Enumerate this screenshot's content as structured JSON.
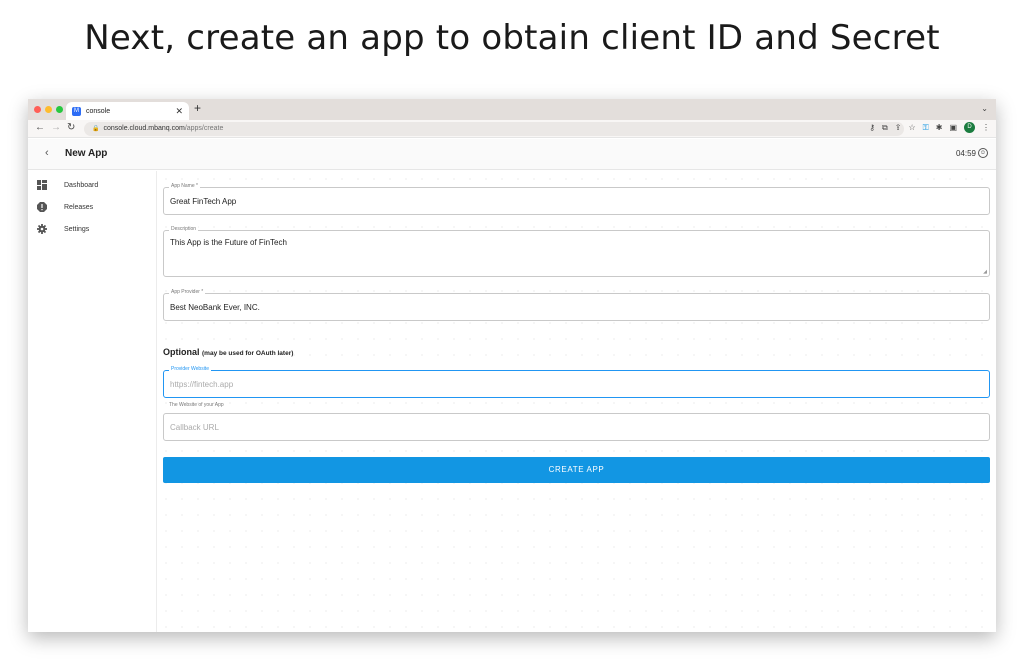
{
  "headline": "Next, create an app to obtain client ID and Secret",
  "browser": {
    "tab_title": "console",
    "tab_favicon": "M",
    "new_tab": "+",
    "url_host": "console.cloud.mbanq.com",
    "url_path": "/apps/create",
    "profile_initial": "D"
  },
  "appbar": {
    "title": "New App",
    "timer": "04:59"
  },
  "sidebar": {
    "items": [
      {
        "label": "Dashboard",
        "icon": "dashboard-icon"
      },
      {
        "label": "Releases",
        "icon": "releases-icon"
      },
      {
        "label": "Settings",
        "icon": "gear-icon"
      }
    ]
  },
  "form": {
    "app_name": {
      "label": "App Name *",
      "value": "Great FinTech App"
    },
    "description": {
      "label": "Description",
      "value": "This App is the Future of FinTech"
    },
    "app_provider": {
      "label": "App Provider *",
      "value": "Best NeoBank Ever, INC."
    },
    "optional_heading": "Optional",
    "optional_note": "(may be used for OAuth later)",
    "provider_website": {
      "label": "Provider Website",
      "placeholder": "https://fintech.app",
      "helper": "The Website of your App"
    },
    "callback_url": {
      "placeholder": "Callback URL"
    },
    "submit_label": "CREATE APP"
  },
  "colors": {
    "accent": "#1296e3",
    "focus": "#2196f3",
    "traffic_red": "#ff5f57",
    "traffic_yellow": "#febc2e",
    "traffic_green": "#28c840"
  }
}
